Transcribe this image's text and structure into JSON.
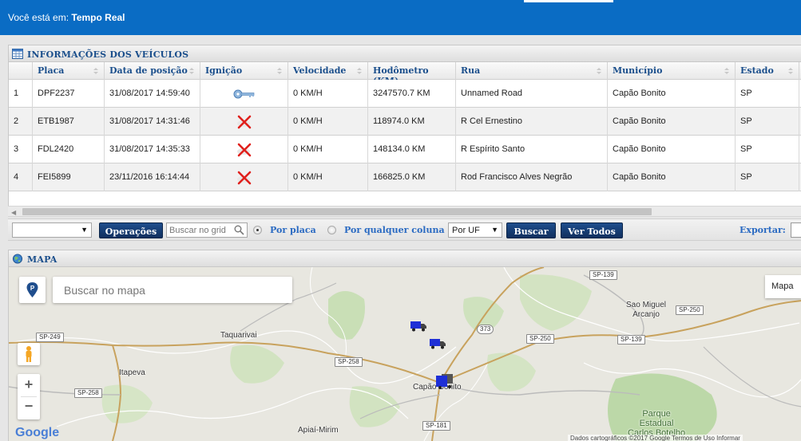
{
  "header": {
    "breadcrumb_prefix": "Você está em:",
    "breadcrumb_page": "Tempo Real"
  },
  "vehicles_panel": {
    "title": "INFORMAÇÕES DOS VEÍCULOS",
    "columns": [
      "Placa",
      "Data de posição",
      "Ignição",
      "Velocidade",
      "Hodômetro (KM)",
      "Rua",
      "Município",
      "Estado"
    ],
    "rows": [
      {
        "n": "1",
        "placa": "DPF2237",
        "data": "31/08/2017 14:59:40",
        "ignicao": "key-icon",
        "velocidade": "0 KM/H",
        "hodometro": "3247570.7 KM",
        "rua": "Unnamed Road",
        "municipio": "Capão Bonito",
        "estado": "SP"
      },
      {
        "n": "2",
        "placa": "ETB1987",
        "data": "31/08/2017 14:31:46",
        "ignicao": "red-x-icon",
        "velocidade": "0 KM/H",
        "hodometro": "118974.0 KM",
        "rua": "R Cel Ernestino",
        "municipio": "Capão Bonito",
        "estado": "SP"
      },
      {
        "n": "3",
        "placa": "FDL2420",
        "data": "31/08/2017 14:35:33",
        "ignicao": "red-x-icon",
        "velocidade": "0 KM/H",
        "hodometro": "148134.0 KM",
        "rua": "R Espírito Santo",
        "municipio": "Capão Bonito",
        "estado": "SP"
      },
      {
        "n": "4",
        "placa": "FEI5899",
        "data": "23/11/2016 16:14:44",
        "ignicao": "red-x-icon",
        "velocidade": "0 KM/H",
        "hodometro": "166825.0 KM",
        "rua": "Rod Francisco Alves Negrão",
        "municipio": "Capão Bonito",
        "estado": "SP"
      }
    ]
  },
  "toolbar": {
    "filter_select_value": "",
    "operations_label": "Operações",
    "search_placeholder": "Buscar no grid",
    "radio_by_plate": "Por placa",
    "radio_any_column": "Por qualquer coluna",
    "uf_select_value": "Por UF",
    "search_button": "Buscar",
    "view_all_button": "Ver Todos",
    "export_label": "Exportar:"
  },
  "map_panel": {
    "title": "MAPA",
    "search_placeholder": "Buscar no mapa",
    "map_type_label": "Mapa",
    "zoom_in": "+",
    "zoom_out": "−",
    "google_logo": "Google",
    "attribution": "Dados cartográficos ©2017 Google   Termos de Uso   Informar",
    "places": {
      "taquarivai": "Taquarivai",
      "itapeva": "Itapeva",
      "capao_bonito": "Capão Bonito",
      "apiai_mirim": "Apiaí-Mirim",
      "sao_miguel": "Sao Miguel\nArcanjo",
      "parque": "Parque\nEstadual\nCarlos Botelho"
    },
    "roads": {
      "sp249": "SP-249",
      "sp258_a": "SP-258",
      "sp258_b": "SP-258",
      "sp139_a": "SP-139",
      "sp139_b": "SP-139",
      "sp250_a": "SP-250",
      "sp250_b": "SP-250",
      "r373": "373",
      "sp181": "SP-181"
    }
  },
  "colors": {
    "header_blue": "#0a6cc4",
    "button_navy": "#163f77",
    "link_blue": "#2a6ac2",
    "title_blue": "#1b4f8c",
    "truck_blue": "#1e2fd6"
  }
}
